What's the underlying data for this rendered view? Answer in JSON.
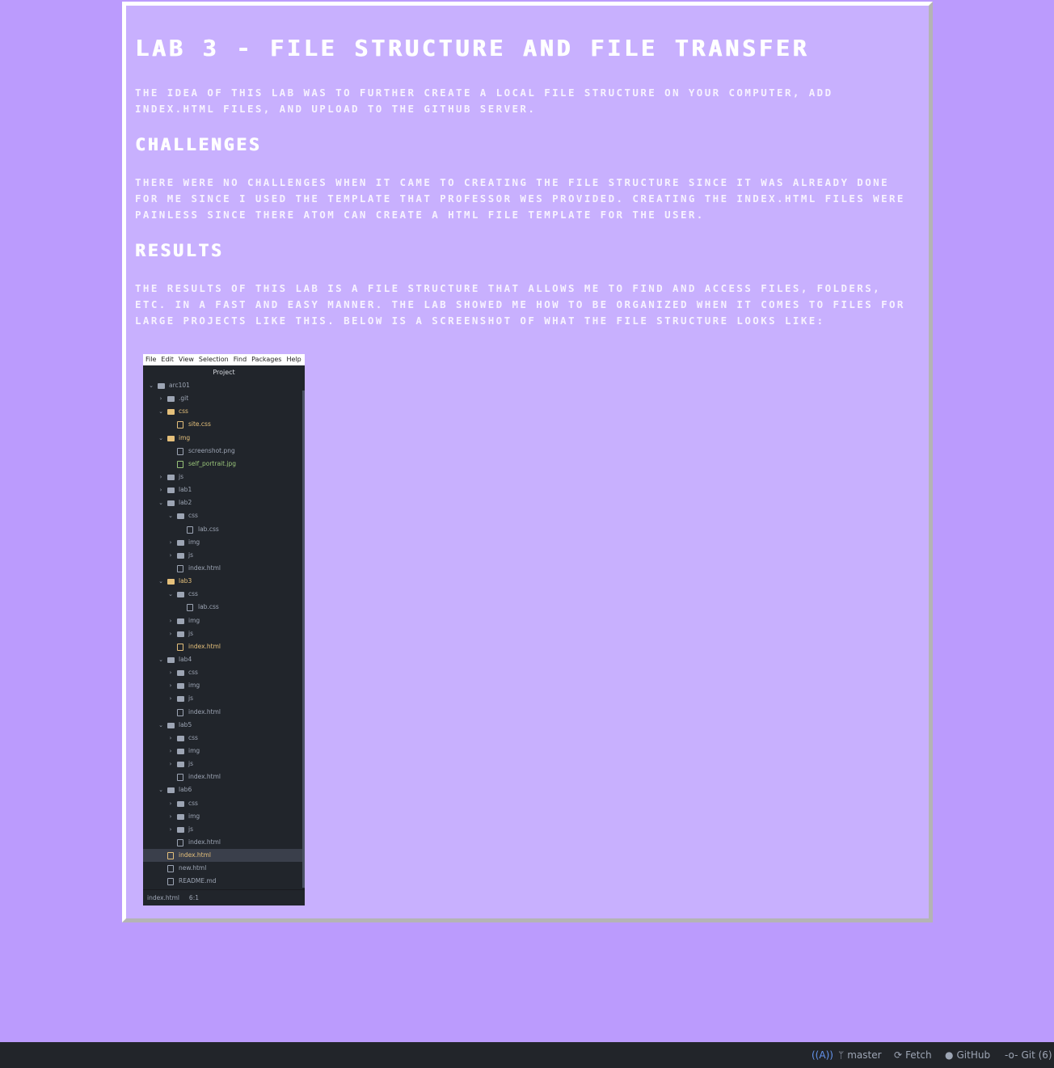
{
  "page": {
    "title": "Lab 3 - File Structure and File Transfer",
    "intro": "The idea of this lab was to further create a local file structure on your computer, add index.html files, and upload to the Github server.",
    "sections": [
      {
        "heading": "Challenges",
        "body": "There were no challenges when it came to creating the file structure since it was already done for me since I used the template that Professor Wes provided. Creating the index.html files were painless since there Atom can create a html file template for the user."
      },
      {
        "heading": "Results",
        "body": "The results of this lab is a file structure that allows me to find and access files, folders, etc. in a fast and easy manner. The lab showed me how to be organized when it comes to files for large projects like this. Below is a screenshot of what the file structure looks like:"
      }
    ]
  },
  "screenshot": {
    "menu": [
      "File",
      "Edit",
      "View",
      "Selection",
      "Find",
      "Packages",
      "Help"
    ],
    "pane_title": "Project",
    "tree": [
      {
        "label": "arc101",
        "depth": 0,
        "type": "root",
        "open": true
      },
      {
        "label": ".git",
        "depth": 1,
        "type": "folder",
        "open": false
      },
      {
        "label": "css",
        "depth": 1,
        "type": "folder",
        "open": true,
        "color": "yellow"
      },
      {
        "label": "site.css",
        "depth": 2,
        "type": "file",
        "color": "yellow"
      },
      {
        "label": "img",
        "depth": 1,
        "type": "folder",
        "open": true,
        "color": "yellow"
      },
      {
        "label": "screenshot.png",
        "depth": 2,
        "type": "file"
      },
      {
        "label": "self_portrait.jpg",
        "depth": 2,
        "type": "file",
        "color": "green"
      },
      {
        "label": "js",
        "depth": 1,
        "type": "folder",
        "open": false
      },
      {
        "label": "lab1",
        "depth": 1,
        "type": "folder",
        "open": false
      },
      {
        "label": "lab2",
        "depth": 1,
        "type": "folder",
        "open": true
      },
      {
        "label": "css",
        "depth": 2,
        "type": "folder",
        "open": true
      },
      {
        "label": "lab.css",
        "depth": 3,
        "type": "file"
      },
      {
        "label": "img",
        "depth": 2,
        "type": "folder",
        "open": false
      },
      {
        "label": "js",
        "depth": 2,
        "type": "folder",
        "open": false
      },
      {
        "label": "index.html",
        "depth": 2,
        "type": "file"
      },
      {
        "label": "lab3",
        "depth": 1,
        "type": "folder",
        "open": true,
        "color": "yellow"
      },
      {
        "label": "css",
        "depth": 2,
        "type": "folder",
        "open": true
      },
      {
        "label": "lab.css",
        "depth": 3,
        "type": "file"
      },
      {
        "label": "img",
        "depth": 2,
        "type": "folder",
        "open": false
      },
      {
        "label": "js",
        "depth": 2,
        "type": "folder",
        "open": false
      },
      {
        "label": "index.html",
        "depth": 2,
        "type": "file",
        "color": "yellow"
      },
      {
        "label": "lab4",
        "depth": 1,
        "type": "folder",
        "open": true
      },
      {
        "label": "css",
        "depth": 2,
        "type": "folder",
        "open": false
      },
      {
        "label": "img",
        "depth": 2,
        "type": "folder",
        "open": false
      },
      {
        "label": "js",
        "depth": 2,
        "type": "folder",
        "open": false
      },
      {
        "label": "index.html",
        "depth": 2,
        "type": "file"
      },
      {
        "label": "lab5",
        "depth": 1,
        "type": "folder",
        "open": true
      },
      {
        "label": "css",
        "depth": 2,
        "type": "folder",
        "open": false
      },
      {
        "label": "img",
        "depth": 2,
        "type": "folder",
        "open": false
      },
      {
        "label": "js",
        "depth": 2,
        "type": "folder",
        "open": false
      },
      {
        "label": "index.html",
        "depth": 2,
        "type": "file"
      },
      {
        "label": "lab6",
        "depth": 1,
        "type": "folder",
        "open": true
      },
      {
        "label": "css",
        "depth": 2,
        "type": "folder",
        "open": false
      },
      {
        "label": "img",
        "depth": 2,
        "type": "folder",
        "open": false
      },
      {
        "label": "js",
        "depth": 2,
        "type": "folder",
        "open": false
      },
      {
        "label": "index.html",
        "depth": 2,
        "type": "file"
      },
      {
        "label": "index.html",
        "depth": 1,
        "type": "file",
        "color": "yellow",
        "selected": true
      },
      {
        "label": "new.html",
        "depth": 1,
        "type": "file"
      },
      {
        "label": "README.md",
        "depth": 1,
        "type": "file"
      }
    ],
    "status_file": "index.html",
    "status_pos": "6:1"
  },
  "statusbar": {
    "branch": "master",
    "fetch": "Fetch",
    "github": "GitHub",
    "git": "Git (6)"
  },
  "colors": {
    "background": "#bb9bfd",
    "panel": "#c8b0fe",
    "statusbar": "#22252a"
  }
}
